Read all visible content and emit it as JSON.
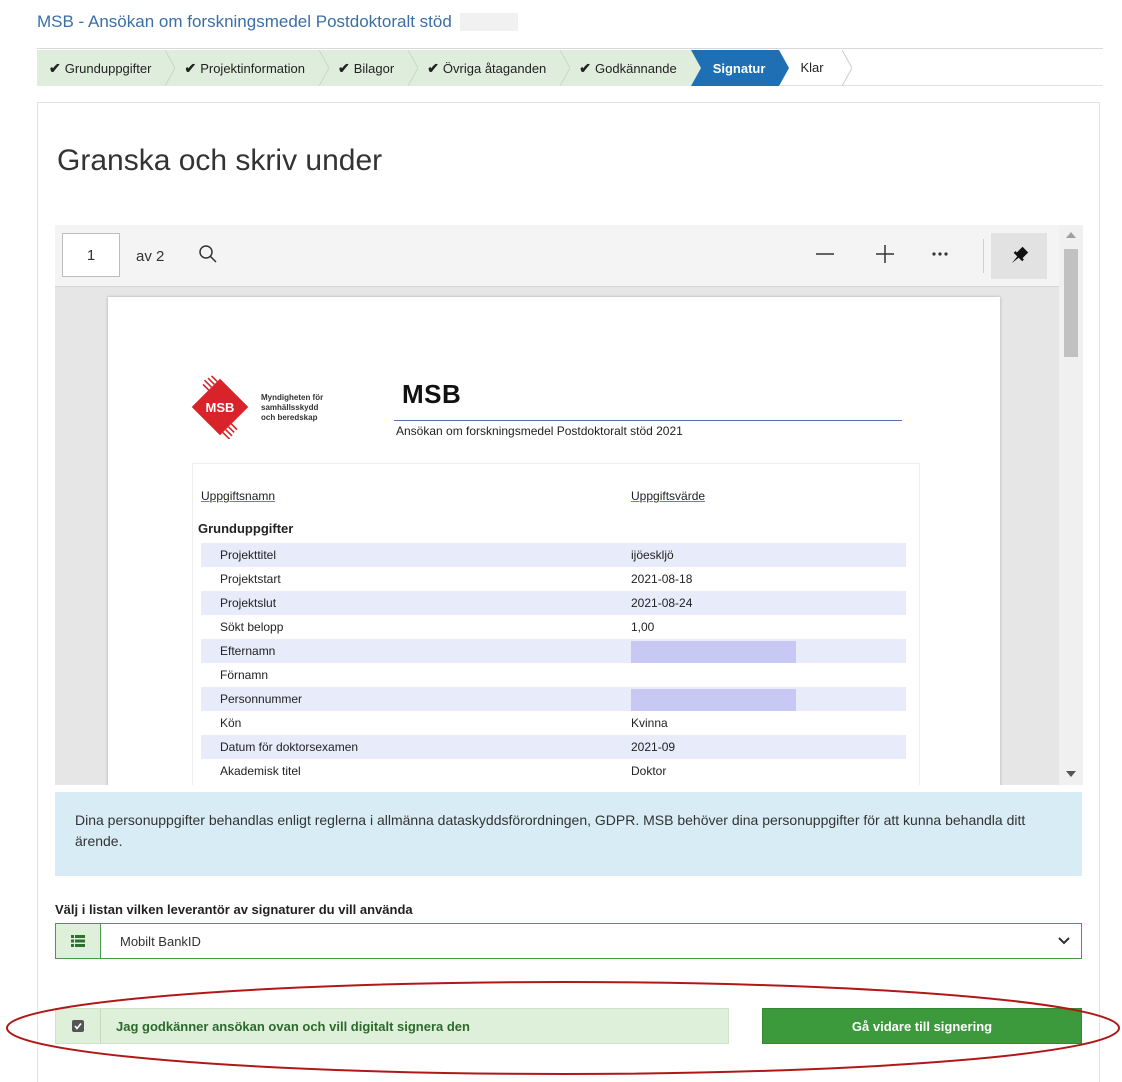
{
  "app": {
    "title": "MSB - Ansökan om forskningsmedel Postdoktoralt stöd"
  },
  "wizard": {
    "steps": [
      {
        "label": "Grunduppgifter",
        "state": "done"
      },
      {
        "label": "Projektinformation",
        "state": "done"
      },
      {
        "label": "Bilagor",
        "state": "done"
      },
      {
        "label": "Övriga åtaganden",
        "state": "done"
      },
      {
        "label": "Godkännande",
        "state": "done"
      },
      {
        "label": "Signatur",
        "state": "active"
      },
      {
        "label": "Klar",
        "state": "pending"
      }
    ],
    "check_glyph": "✔"
  },
  "main": {
    "title": "Granska och skriv under"
  },
  "viewer": {
    "page_number": "1",
    "page_of": "av 2",
    "icons": [
      "search-icon",
      "zoom-out-icon",
      "zoom-in-icon",
      "more-options-icon",
      "pin-icon"
    ]
  },
  "document": {
    "logo_text": "MSB",
    "logo_org_line1": "Myndigheten för",
    "logo_org_line2": "samhällsskydd",
    "logo_org_line3": "och beredskap",
    "brand": "MSB",
    "subtitle": "Ansökan om forskningsmedel Postdoktoralt stöd 2021",
    "col_name": "Uppgiftsnamn",
    "col_value": "Uppgiftsvärde",
    "section": "Grunduppgifter",
    "rows": [
      {
        "key": "Projekttitel",
        "value": "ijöesklj­ö",
        "redacted": false
      },
      {
        "key": "Projektstart",
        "value": "2021-08-18",
        "redacted": false
      },
      {
        "key": "Projektslut",
        "value": "2021-08-24",
        "redacted": false
      },
      {
        "key": "Sökt belopp",
        "value": "1,00",
        "redacted": false
      },
      {
        "key": "Efternamn",
        "value": "",
        "redacted": true
      },
      {
        "key": "Förnamn",
        "value": "",
        "redacted": false
      },
      {
        "key": "Personnummer",
        "value": "",
        "redacted": true
      },
      {
        "key": "Kön",
        "value": "Kvinna",
        "redacted": false
      },
      {
        "key": "Datum för doktorsexamen",
        "value": "2021-09",
        "redacted": false
      },
      {
        "key": "Akademisk titel",
        "value": "Doktor",
        "redacted": false
      }
    ]
  },
  "gdpr": {
    "text": "Dina personuppgifter behandlas enligt reglerna i allmänna dataskyddsförordningen, GDPR. MSB behöver dina personuppgifter för att kunna behandla ditt ärende."
  },
  "signature": {
    "select_label": "Välj i listan vilken leverantör av signaturer du vill använda",
    "selected_provider": "Mobilt BankID",
    "consent_label": "Jag godkänner ansökan ovan och vill digitalt signera den",
    "consent_checked": true,
    "proceed_label": "Gå vidare till signering"
  },
  "colors": {
    "accent_blue": "#1e6fb3",
    "success_green": "#3c9a3c",
    "done_step_bg": "#dfeedc",
    "gdpr_bg": "#d8ecf5",
    "annotation_red": "#b01818"
  }
}
